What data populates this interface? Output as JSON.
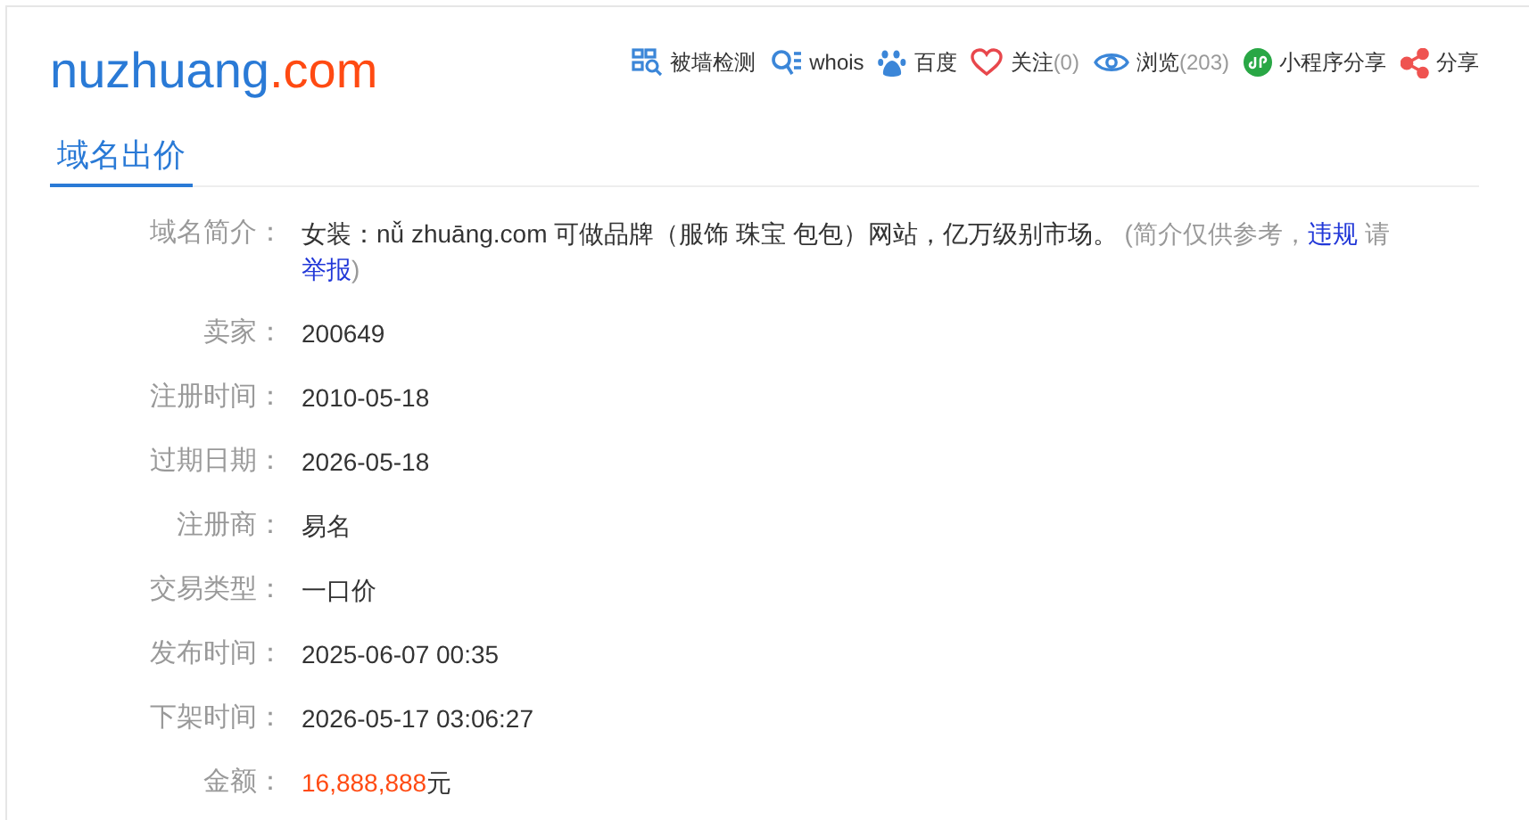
{
  "logo": {
    "name": "nuzhuang",
    "tld": ".com"
  },
  "actions": [
    {
      "kind": "wall-check",
      "label": "被墙检测"
    },
    {
      "kind": "whois",
      "label": "whois"
    },
    {
      "kind": "baidu",
      "label": "百度"
    },
    {
      "kind": "follow",
      "label": "关注",
      "count": "(0)"
    },
    {
      "kind": "views",
      "label": "浏览",
      "count": "(203)"
    },
    {
      "kind": "mini-program",
      "label": "小程序分享"
    },
    {
      "kind": "share",
      "label": "分享"
    }
  ],
  "tabs": [
    {
      "label": "域名出价",
      "selected": true
    }
  ],
  "fields": [
    {
      "label": "域名简介：",
      "segments": [
        {
          "kind": "text",
          "text": "女装：nǚ zhuāng.com 可做品牌（服饰 珠宝 包包）网站，亿万级别市场。"
        },
        {
          "kind": "note",
          "text": " (简介仅供参考，"
        },
        {
          "kind": "link",
          "text": "违规"
        },
        {
          "kind": "note",
          "text": " 请 "
        },
        {
          "kind": "link",
          "text": "举报"
        },
        {
          "kind": "note",
          "text": ")"
        }
      ]
    },
    {
      "label": "卖家：",
      "value": "200649"
    },
    {
      "label": "注册时间：",
      "value": "2010-05-18"
    },
    {
      "label": "过期日期：",
      "value": "2026-05-18"
    },
    {
      "label": "注册商：",
      "value": "易名"
    },
    {
      "label": "交易类型：",
      "value": "一口价"
    },
    {
      "label": "发布时间：",
      "value": "2025-06-07 00:35"
    },
    {
      "label": "下架时间：",
      "value": "2026-05-17 03:06:27"
    },
    {
      "label": "金额：",
      "amount": "16,888,888",
      "unit": "元"
    }
  ]
}
